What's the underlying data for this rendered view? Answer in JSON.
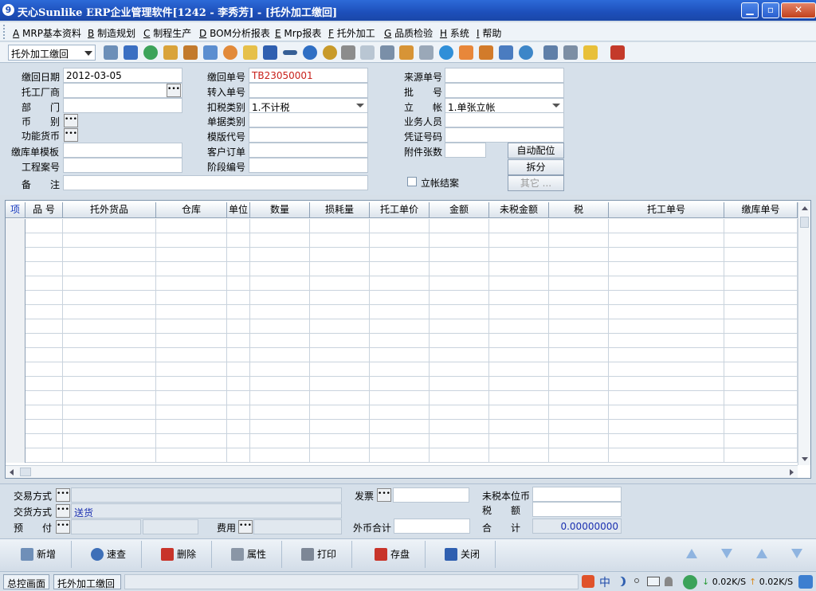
{
  "window": {
    "title": "天心Sunlike ERP企业管理软件[1242 - 李秀芳] - [托外加工缴回]",
    "minimize_label": "▁",
    "restore_label": "▫",
    "close_label": "✕"
  },
  "menu": [
    {
      "key": "A",
      "label": "MRP基本资料"
    },
    {
      "key": "B",
      "label": "制造规划"
    },
    {
      "key": "C",
      "label": "制程生产"
    },
    {
      "key": "D",
      "label": "BOM分析报表"
    },
    {
      "key": "E",
      "label": "Mrp报表"
    },
    {
      "key": "F",
      "label": "托外加工"
    },
    {
      "key": "G",
      "label": "品质检验"
    },
    {
      "key": "H",
      "label": "系统"
    },
    {
      "key": "I",
      "label": "帮助"
    }
  ],
  "toolbar": {
    "module_select": "托外加工缴回",
    "icons": [
      "tree-icon",
      "monitor-icon",
      "phone-icon",
      "key-icon",
      "briefcase-icon",
      "home-icon",
      "users-icon",
      "mail-icon",
      "book-icon",
      "arrow-icon",
      "help-icon",
      "dollar-icon",
      "cart-icon",
      "document-icon",
      "calculator-icon",
      "archive-icon",
      "copy-icon",
      "check-icon",
      "bell-icon",
      "warehouse-icon",
      "transfer-icon",
      "refresh-icon",
      "window-icon",
      "close-window-icon",
      "tile-icon",
      "exit-icon"
    ]
  },
  "form": {
    "return_date_label": "缴回日期",
    "return_date": "2012-03-05",
    "vendor_label": "托工厂商",
    "dept_label": "部　　门",
    "currency_label": "币　　别",
    "func_currency_label": "功能货币",
    "template_label": "缴库单模板",
    "project_label": "工程案号",
    "remark_label": "备　　注",
    "return_no_label": "缴回单号",
    "return_no": "TB23050001",
    "transfer_no_label": "转入单号",
    "tax_type_label": "扣税类别",
    "tax_type": "1.不计税",
    "doc_type_label": "单据类别",
    "template_code_label": "模版代号",
    "customer_order_label": "客户订单",
    "stage_no_label": "阶段编号",
    "source_no_label": "来源单号",
    "batch_label": "批　　号",
    "account_label": "立　　帐",
    "account_value": "1.单张立帐",
    "staff_label": "业务人员",
    "voucher_label": "凭证号码",
    "attach_label": "附件张数",
    "auto_alloc_label": "自动配位",
    "split_label": "拆分",
    "other_label": "其它 ...",
    "close_account_label": "立帐结案"
  },
  "grid": {
    "columns": [
      "项",
      "品 号",
      "托外货品",
      "仓库",
      "单位",
      "数量",
      "损耗量",
      "托工单价",
      "金额",
      "未税金额",
      "税",
      "托工单号",
      "缴库单号"
    ],
    "row_count": 17
  },
  "footer": {
    "trade_mode_label": "交易方式",
    "delivery_mode_label": "交货方式",
    "delivery_mode": "送货",
    "prepay_label": "预　　付",
    "cost_label": "费用",
    "invoice_label": "发票",
    "foreign_total_label": "外币合计",
    "untaxed_label": "未税本位币",
    "tax_label": "税　　额",
    "total_label": "合　　计",
    "total_value": "0.00000000"
  },
  "actions": [
    {
      "name": "add",
      "label": "新增"
    },
    {
      "name": "query",
      "label": "速查"
    },
    {
      "name": "delete",
      "label": "删除"
    },
    {
      "name": "properties",
      "label": "属性"
    },
    {
      "name": "print",
      "label": "打印"
    },
    {
      "name": "save",
      "label": "存盘"
    },
    {
      "name": "close",
      "label": "关闭"
    }
  ],
  "status": {
    "tab1": "总控画面",
    "tab2": "托外加工缴回",
    "ime": "中",
    "download": "0.02K/S",
    "upload": "0.02K/S"
  },
  "colors": {
    "title_bar": "#1d4fba",
    "doc_number": "#c8201a",
    "value_blue": "#1a2fb0"
  }
}
